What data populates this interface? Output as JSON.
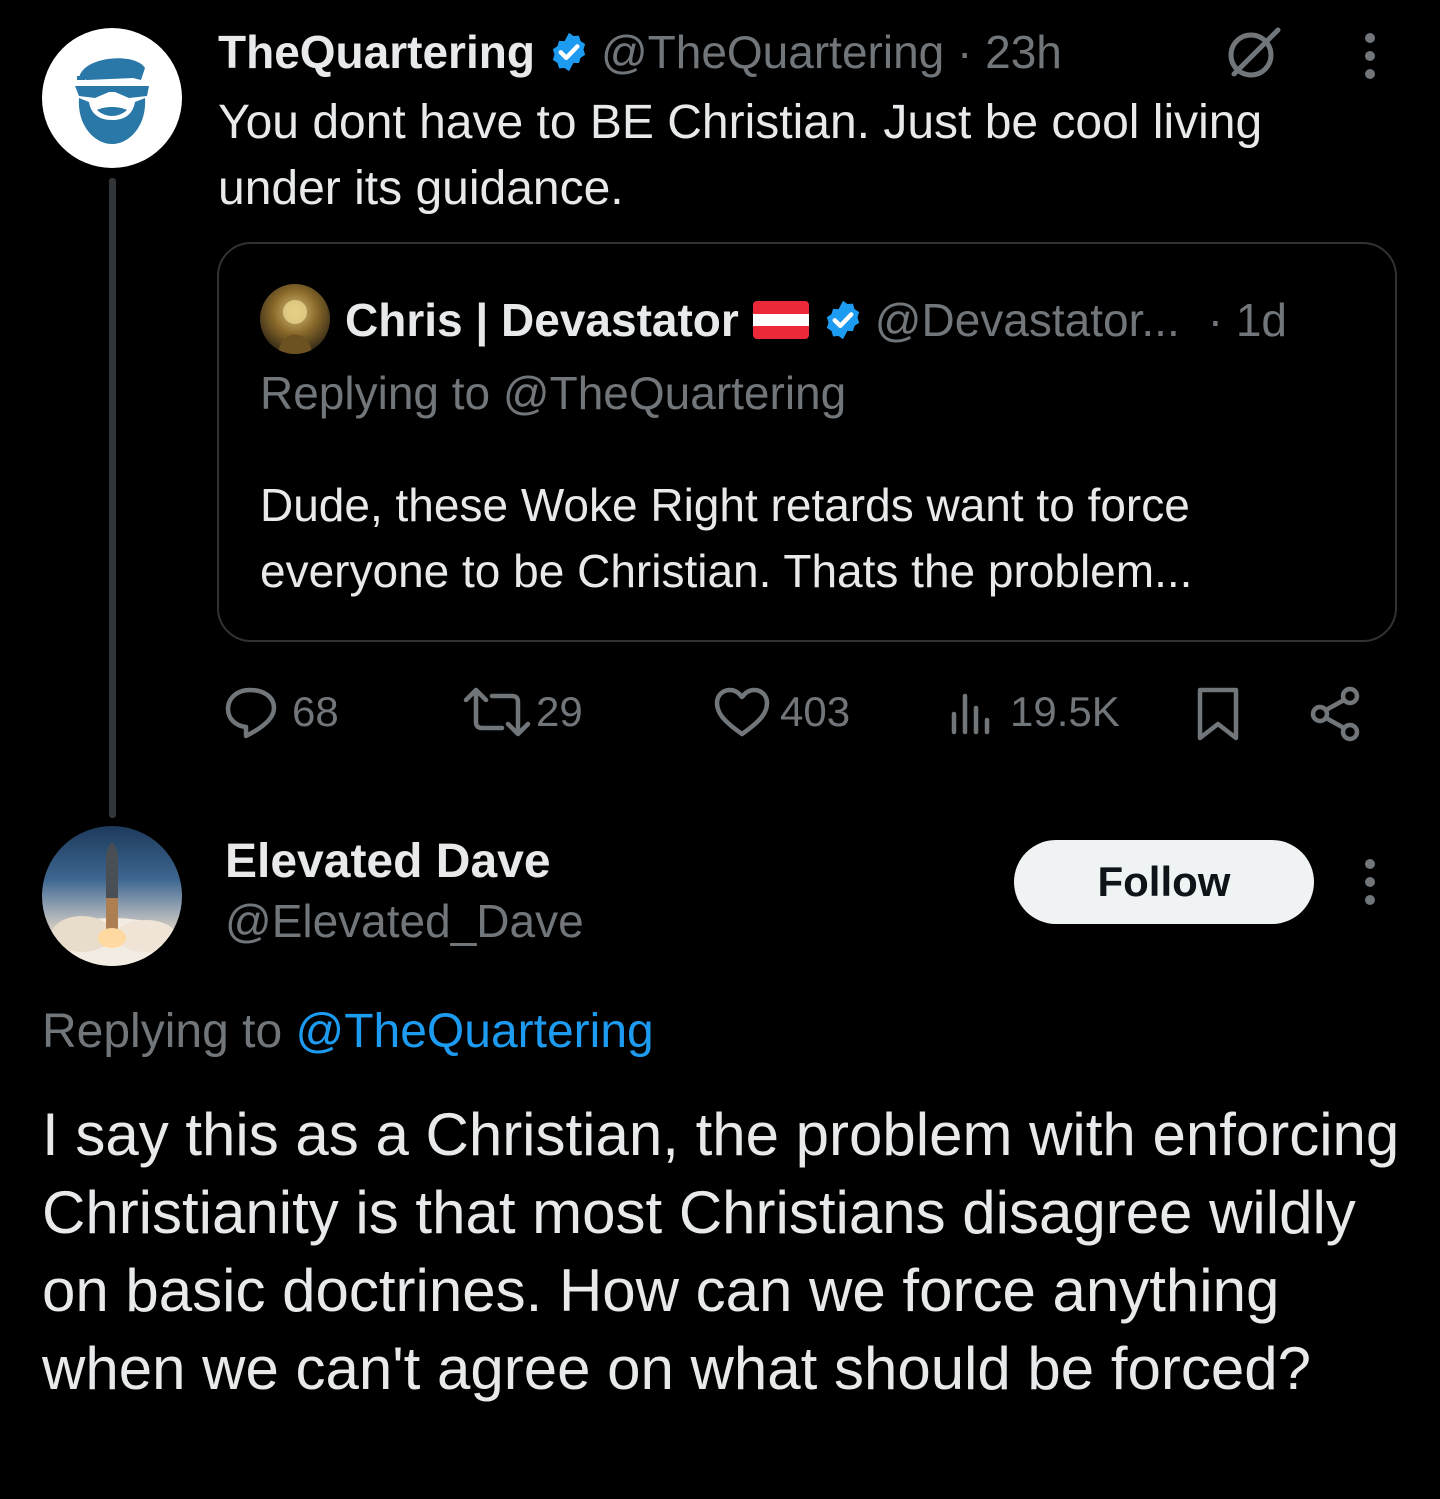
{
  "tweet": {
    "author_name": "TheQuartering",
    "author_handle": "@TheQuartering",
    "time": "23h",
    "text": "You dont have to BE Christian. Just be cool living under its guidance.",
    "quoted": {
      "author_name": "Chris | Devastator",
      "author_handle": "@Devastator...",
      "time": "1d",
      "replying_prefix": "Replying to",
      "replying_handle": "@TheQuartering",
      "text": "Dude, these Woke Right retards want to force everyone to be Christian. Thats the problem..."
    },
    "stats": {
      "replies": "68",
      "retweets": "29",
      "likes": "403",
      "views": "19.5K"
    }
  },
  "reply": {
    "author_name": "Elevated Dave",
    "author_handle": "@Elevated_Dave",
    "follow_label": "Follow",
    "replying_prefix": "Replying to",
    "replying_handle": "@TheQuartering",
    "text": "I say this as a Christian, the problem with enforcing Christianity is that most Christians disagree wildly on basic doctrines. How can we force anything when we can't agree on what should be forced?"
  },
  "colors": {
    "background": "#000000",
    "text": "#e7e9ea",
    "muted": "#71767b",
    "link": "#1d9bf0",
    "verified": "#1d9bf0"
  },
  "icons": [
    "avatar-beard-logo",
    "verified-badge",
    "grok-icon",
    "more-icon",
    "austria-flag",
    "reply-icon",
    "retweet-icon",
    "like-icon",
    "views-icon",
    "bookmark-icon",
    "share-icon"
  ]
}
